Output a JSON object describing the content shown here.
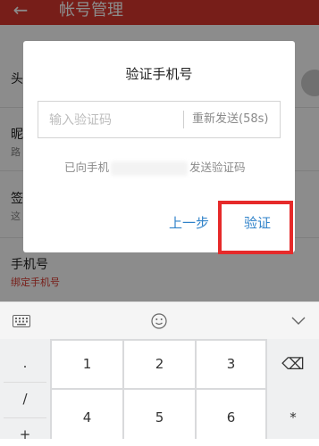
{
  "header": {
    "back_icon": "←",
    "title": "帐号管理"
  },
  "page_rows": [
    {
      "label": "头",
      "sub": ""
    },
    {
      "label": "昵",
      "sub": "路"
    },
    {
      "label": "签",
      "sub": "这"
    },
    {
      "label": "手机号",
      "sub": "绑定手机号"
    }
  ],
  "dialog": {
    "title": "验证手机号",
    "code_placeholder": "输入验证码",
    "code_value": "",
    "resend_label": "重新发送(58s)",
    "sent_prefix": "已向手机",
    "sent_suffix": "发送验证码",
    "prev_label": "上一步",
    "verify_label": "验证",
    "highlight_color": "#e62a2a",
    "accent_color": "#2f82c9"
  },
  "keyboard": {
    "toolbar": {
      "left_icon": "keyboard-icon",
      "center_icon": "emoji-icon",
      "right_icon": "chevron-down-icon"
    },
    "side_left": [
      ".",
      "/",
      "+"
    ],
    "digits": [
      "1",
      "2",
      "3",
      "4",
      "5",
      "6"
    ],
    "side_right": [
      "⌫",
      "*"
    ]
  }
}
